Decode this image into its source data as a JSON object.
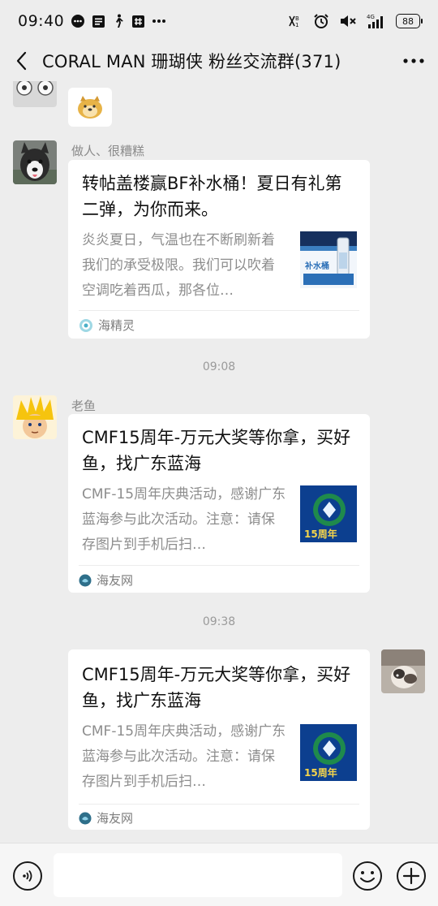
{
  "status_bar": {
    "time": "09:40",
    "battery": "88",
    "signal_label": "4G"
  },
  "nav": {
    "title": "CORAL MAN 珊瑚侠 粉丝交流群(371)"
  },
  "messages": [
    {
      "sender": "做人、很糟糕",
      "title": "转帖盖楼赢BF补水桶！夏日有礼第二弹，为你而来。",
      "desc": "炎炎夏日，气温也在不断刷新着我们的承受极限。我们可以吹着空调吃着西瓜，那各位…",
      "source": "海精灵",
      "thumb_text": "补水桶"
    },
    {
      "timestamp": "09:08",
      "sender": "老鱼",
      "title": "CMF15周年-万元大奖等你拿，买好鱼，找广东蓝海",
      "desc": "CMF-15周年庆典活动，感谢广东蓝海参与此次活动。注意：请保存图片到手机后扫…",
      "source": "海友网",
      "thumb_text": "15周年"
    },
    {
      "timestamp": "09:38",
      "title": "CMF15周年-万元大奖等你拿，买好鱼，找广东蓝海",
      "desc": "CMF-15周年庆典活动，感谢广东蓝海参与此次活动。注意：请保存图片到手机后扫…",
      "source": "海友网",
      "thumb_text": "15周年"
    }
  ],
  "icons": {
    "back": "chevron-left-icon",
    "more": "more-icon",
    "voice": "voice-icon",
    "emoji": "emoji-icon",
    "plus": "plus-icon"
  },
  "colors": {
    "background": "#ededed",
    "bubble": "#ffffff",
    "muted_text": "#8d8d8d"
  }
}
